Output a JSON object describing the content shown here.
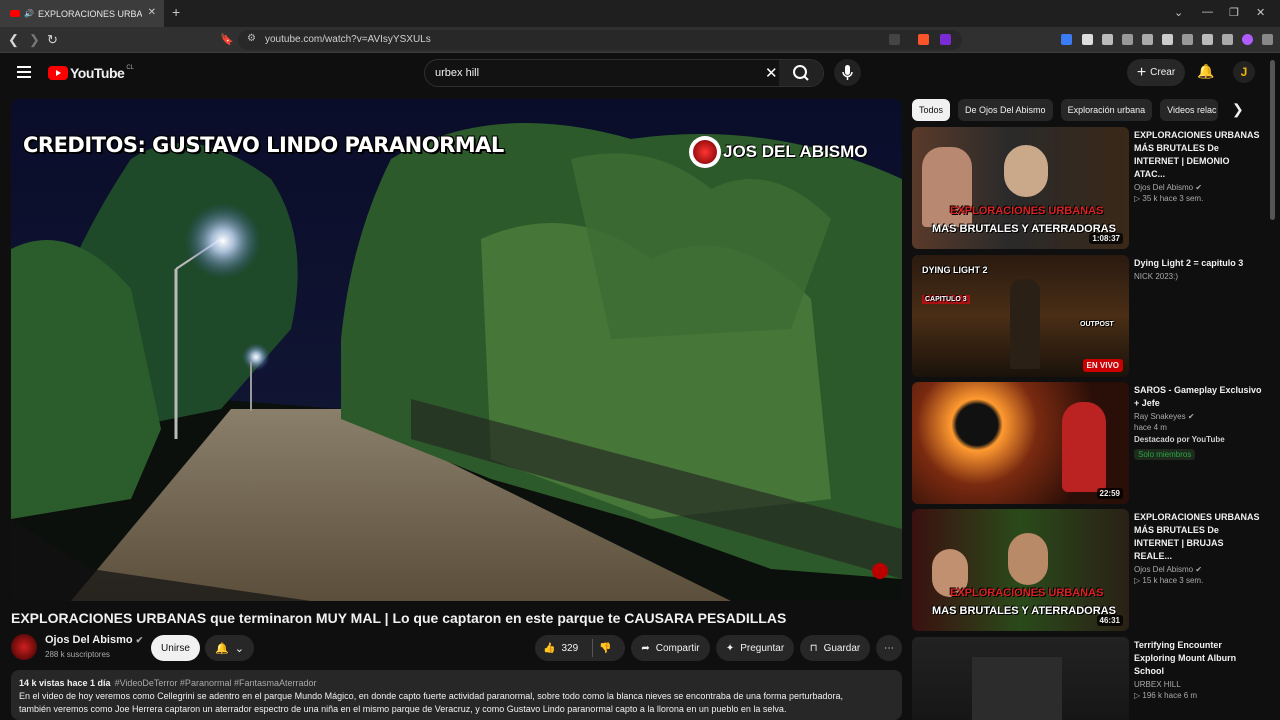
{
  "browser": {
    "tab_title": "EXPLORACIONES URBANAS q",
    "url": "youtube.com/watch?v=AVIsyYSXULs",
    "new_tab": "+",
    "tab_close": "✕"
  },
  "masthead": {
    "logo_text": "YouTube",
    "country": "CL",
    "search_query": "urbex hill",
    "create_label": "Crear",
    "avatar_letter": "J"
  },
  "player": {
    "overlay_credit": "CREDITOS: GUSTAVO LINDO PARANORMAL",
    "watermark": "JOS DEL ABISMO"
  },
  "video": {
    "title": "EXPLORACIONES URBANAS que terminaron MUY MAL | Lo que captaron en este parque te CAUSARA PESADILLAS",
    "channel": "Ojos Del Abismo",
    "subscribers": "288 k suscriptores",
    "join_label": "Unirse",
    "likes": "329",
    "share_label": "Compartir",
    "ask_label": "Preguntar",
    "save_label": "Guardar",
    "views_date": "14 k vistas  hace 1 día",
    "tags": "#VideoDeTerror #Paranormal #FantasmaAterrador",
    "description_line1": "En el video de hoy veremos como Cellegrini se adentro en el parque Mundo Mágico, en donde capto fuerte actividad paranormal, sobre todo como la blanca nieves se encontraba de una forma perturbadora,",
    "description_line2": "también veremos como Joe Herrera captaron un aterrador espectro de una niña en el mismo parque de Veracruz, y como Gustavo Lindo paranormal capto a la llorona en un pueblo en la selva."
  },
  "chips": [
    "Todos",
    "De Ojos Del Abismo",
    "Exploración urbana",
    "Videos relac"
  ],
  "recommendations": [
    {
      "title": "EXPLORACIONES URBANAS MÁS BRUTALES De INTERNET | DEMONIO ATAC...",
      "channel": "Ojos Del Abismo",
      "meta": "35 k   hace 3 sem.",
      "duration": "1:08:37",
      "overlay1": "EXPLORACIONES URBANAS",
      "overlay2": "MAS BRUTALES Y ATERRADORAS"
    },
    {
      "title": "Dying Light 2 = capitulo 3",
      "channel": "NICK 2023:)",
      "live": "EN VIVO",
      "overlay1": "DYING LIGHT 2",
      "overlay2": "CAPITULO 3",
      "overlay3": "OUTPOST"
    },
    {
      "title": "SAROS - Gameplay Exclusivo + Jefe",
      "channel": "Ray Snakeyes",
      "meta": "hace 4 m",
      "featured": "Destacado por YouTube",
      "members": "Solo miembros",
      "duration": "22:59"
    },
    {
      "title": "EXPLORACIONES URBANAS MÁS BRUTALES De INTERNET  | BRUJAS REALE...",
      "channel": "Ojos Del Abismo",
      "meta": "15 k   hace 3 sem.",
      "duration": "46:31",
      "overlay1": "EXPLORACIONES URBANAS",
      "overlay2": "MAS BRUTALES Y ATERRADORAS"
    },
    {
      "title": "Terrifying Encounter Exploring Mount Alburn School",
      "channel": "URBEX HILL",
      "meta": "196 k   hace 6 m"
    }
  ]
}
